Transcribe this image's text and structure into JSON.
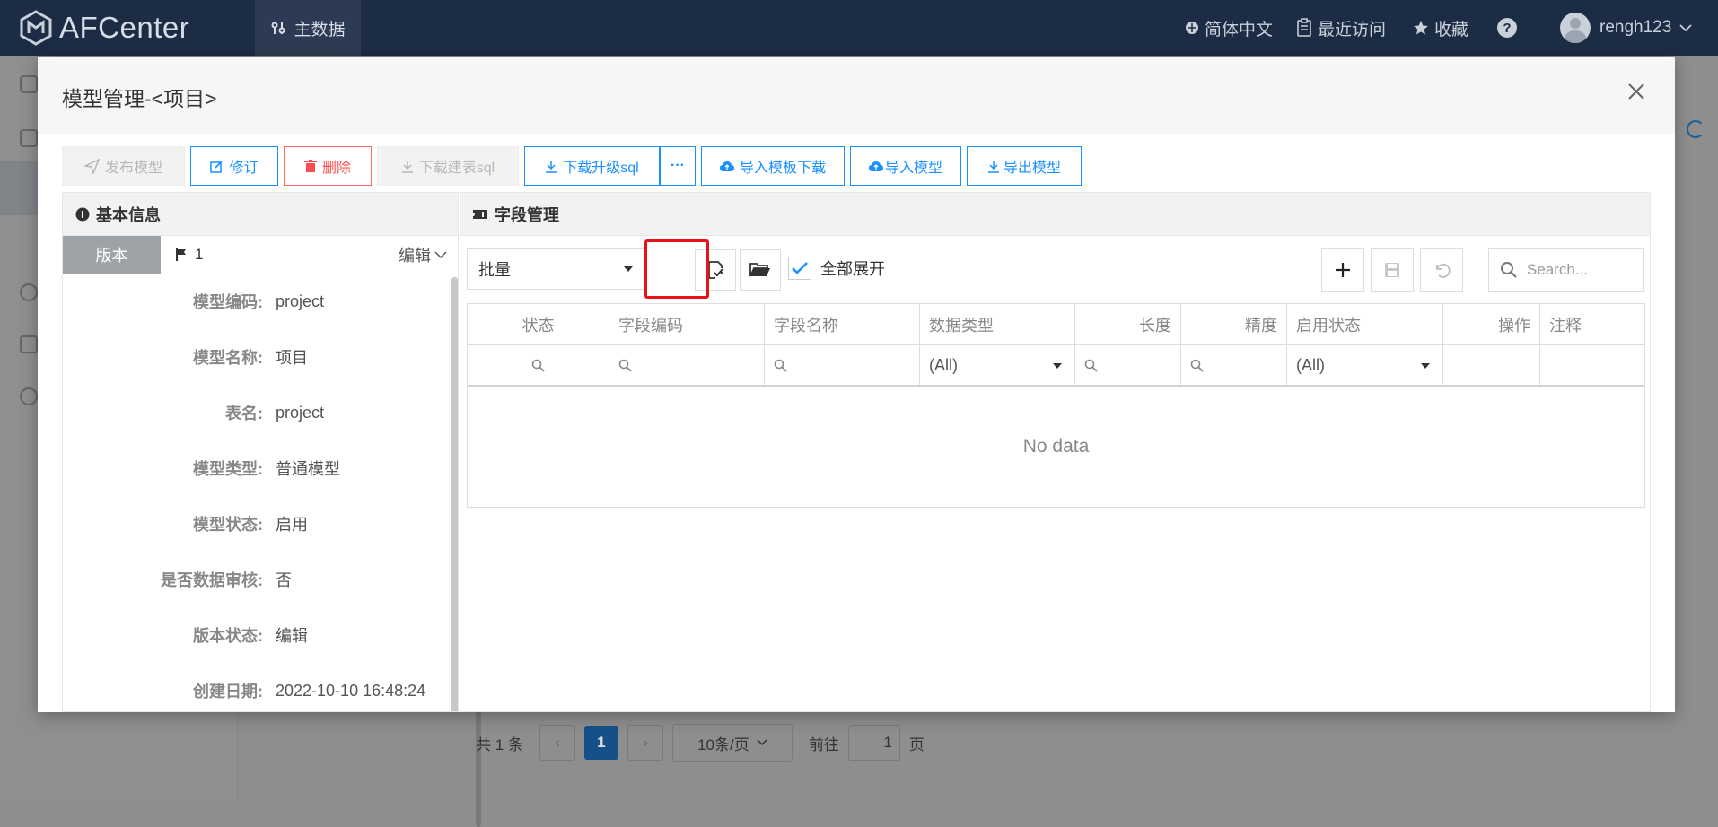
{
  "app": {
    "title": "AFCenter",
    "nav_tab": "主数据",
    "language": "简体中文",
    "recent": "最近访问",
    "favorite": "收藏",
    "help": "?",
    "user": "rengh123"
  },
  "pager": {
    "total": "共 1 条",
    "current_page": "1",
    "page_size": "10条/页",
    "goto_label": "前往",
    "goto_value": "1",
    "page_unit": "页"
  },
  "modal": {
    "title": "模型管理-<项目>",
    "toolbar": {
      "publish": "发布模型",
      "revise": "修订",
      "delete": "删除",
      "download_create_sql": "下载建表sql",
      "download_upgrade_sql": "下载升级sql",
      "more": "···",
      "import_template_download": "导入模板下载",
      "import_model": "导入模型",
      "export_model": "导出模型"
    },
    "basic_info": {
      "header": "基本信息",
      "version_tab": "版本",
      "version_value": "1",
      "version_edit": "编辑",
      "rows": [
        {
          "label": "模型编码:",
          "value": "project"
        },
        {
          "label": "模型名称:",
          "value": "项目"
        },
        {
          "label": "表名:",
          "value": "project"
        },
        {
          "label": "模型类型:",
          "value": "普通模型"
        },
        {
          "label": "模型状态:",
          "value": "启用"
        },
        {
          "label": "是否数据审核:",
          "value": "否"
        },
        {
          "label": "版本状态:",
          "value": "编辑"
        },
        {
          "label": "创建日期:",
          "value": "2022-10-10 16:48:24"
        }
      ]
    },
    "fields": {
      "header": "字段管理",
      "batch_select": "批量",
      "expand_all": "全部展开",
      "search_placeholder": "Search...",
      "columns": [
        "状态",
        "字段编码",
        "字段名称",
        "数据类型",
        "长度",
        "精度",
        "启用状态",
        "操作",
        "注释"
      ],
      "filter_all_1": "(All)",
      "filter_all_2": "(All)",
      "no_data": "No data"
    }
  },
  "colors": {
    "topbar": "#1c2c44",
    "accent": "#1890ff",
    "danger": "#ff4d4f",
    "highlight": "#e8121a"
  }
}
